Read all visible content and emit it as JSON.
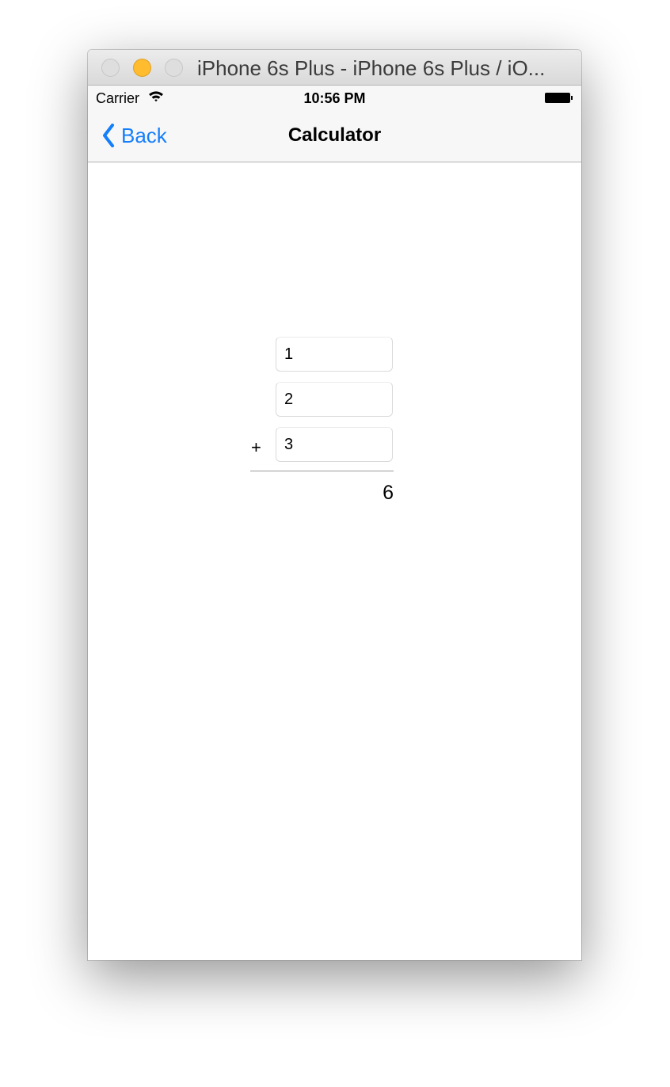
{
  "window": {
    "title": "iPhone 6s Plus - iPhone 6s Plus / iO..."
  },
  "status_bar": {
    "carrier": "Carrier",
    "time": "10:56 PM"
  },
  "nav_bar": {
    "back_label": "Back",
    "title": "Calculator"
  },
  "calculator": {
    "addends": [
      "1",
      "2",
      "3"
    ],
    "operator": "+",
    "sum": "6"
  },
  "colors": {
    "tint": "#147efb",
    "minimize_light": "#febc2e"
  },
  "icons": [
    "wifi-icon",
    "battery-icon",
    "chevron-left-icon"
  ]
}
